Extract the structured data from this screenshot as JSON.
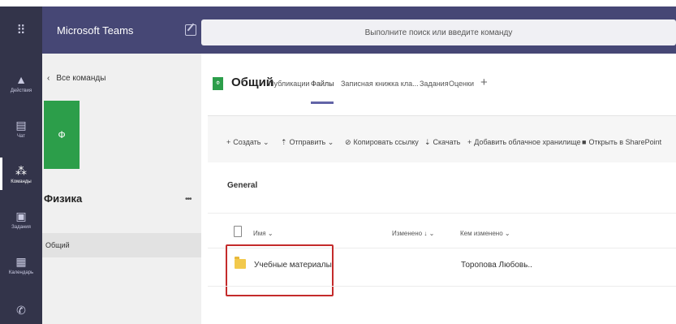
{
  "app": {
    "title": "Microsoft Teams",
    "search_placeholder": "Выполните поиск или введите команду"
  },
  "rail": {
    "items": [
      {
        "label": "Действия",
        "icon": "bell-icon",
        "glyph": "🔔"
      },
      {
        "label": "Чат",
        "icon": "chat-icon",
        "glyph": "▤"
      },
      {
        "label": "Команды",
        "icon": "teams-icon",
        "glyph": "⁂"
      },
      {
        "label": "Задания",
        "icon": "assignments-icon",
        "glyph": "▣"
      },
      {
        "label": "Календарь",
        "icon": "calendar-icon",
        "glyph": "▦"
      }
    ]
  },
  "panel": {
    "back_label": "Все команды",
    "team_avatar": "Ф",
    "team_name": "Физика",
    "more": "•••",
    "channels": [
      "Общий"
    ]
  },
  "channel": {
    "avatar": "Ф",
    "title": "Общий",
    "tabs": [
      "Публикации",
      "Файлы",
      "Записная книжка кла...",
      "Задания",
      "Оценки"
    ],
    "active_tab": "Файлы",
    "add_tab": "+"
  },
  "toolbar": {
    "create": "Создать",
    "send": "Отправить",
    "copy_link": "Копировать ссылку",
    "download": "Скачать",
    "add_storage": "Добавить облачное хранилище",
    "open_sharepoint": "Открыть в SharePoint"
  },
  "files": {
    "folder_title": "General",
    "columns": [
      "Имя",
      "Изменено",
      "Кем изменено"
    ],
    "rows": [
      {
        "name": "Учебные материалы",
        "modified": "",
        "modified_by": "Торопова Любовь.."
      }
    ]
  },
  "colors": {
    "topbar": "#464775",
    "rail": "#33344a",
    "accent": "#6264a7",
    "team": "#2c9e4a",
    "highlight": "#c42b2b"
  }
}
